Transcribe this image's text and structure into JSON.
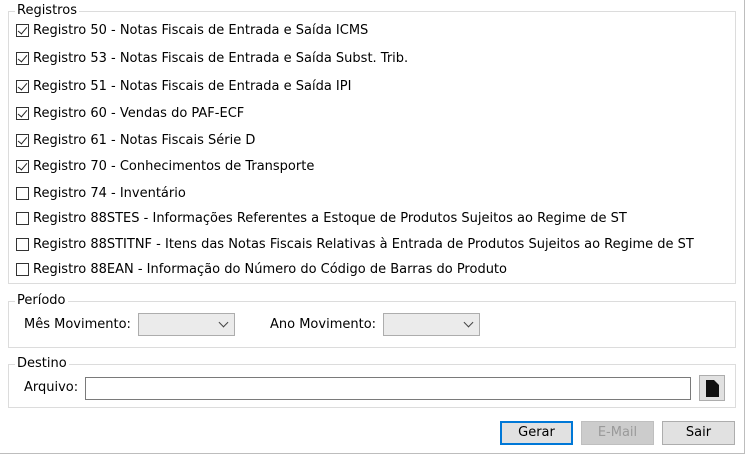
{
  "registros": {
    "legend": "Registros",
    "items": [
      {
        "label": "Registro 50 - Notas Fiscais de Entrada e Saída ICMS",
        "checked": true
      },
      {
        "label": "Registro 53 - Notas Fiscais de Entrada e Saída Subst. Trib.",
        "checked": true
      },
      {
        "label": "Registro 51 - Notas Fiscais de Entrada e Saída IPI",
        "checked": true
      },
      {
        "label": "Registro 60 - Vendas do PAF-ECF",
        "checked": true
      },
      {
        "label": "Registro 61 - Notas Fiscais Série D",
        "checked": true
      },
      {
        "label": "Registro 70 - Conhecimentos de Transporte",
        "checked": true
      },
      {
        "label": "Registro 74 - Inventário",
        "checked": false
      },
      {
        "label": "Registro 88STES - Informações Referentes a Estoque de Produtos Sujeitos ao Regime de ST",
        "checked": false
      },
      {
        "label": "Registro 88STITNF - Itens das Notas Fiscais Relativas à Entrada de Produtos Sujeitos ao Regime de ST",
        "checked": false
      },
      {
        "label": "Registro 88EAN - Informação do Número do Código de Barras do Produto",
        "checked": false
      }
    ]
  },
  "periodo": {
    "legend": "Período",
    "mes_label": "Mês Movimento:",
    "mes_value": "",
    "ano_label": "Ano Movimento:",
    "ano_value": ""
  },
  "destino": {
    "legend": "Destino",
    "arquivo_label": "Arquivo:",
    "arquivo_value": "",
    "file_icon": "document-icon"
  },
  "buttons": {
    "gerar": "Gerar",
    "email": "E-Mail",
    "sair": "Sair"
  }
}
